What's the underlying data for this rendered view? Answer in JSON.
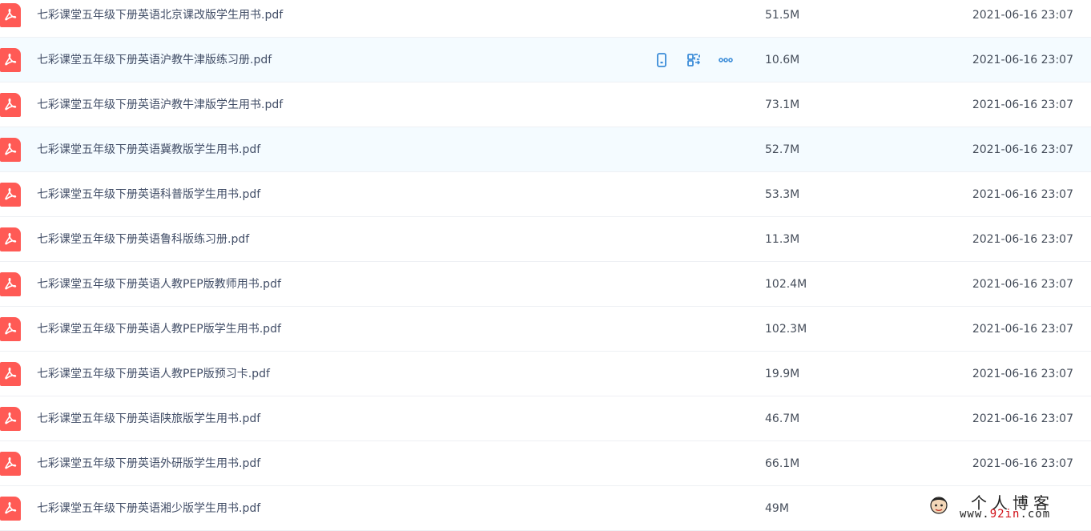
{
  "files": [
    {
      "name": "七彩课堂五年级下册英语北京课改版学生用书.pdf",
      "size": "51.5M",
      "date": "2021-06-16 23:07"
    },
    {
      "name": "七彩课堂五年级下册英语沪教牛津版练习册.pdf",
      "size": "10.6M",
      "date": "2021-06-16 23:07"
    },
    {
      "name": "七彩课堂五年级下册英语沪教牛津版学生用书.pdf",
      "size": "73.1M",
      "date": "2021-06-16 23:07"
    },
    {
      "name": "七彩课堂五年级下册英语冀教版学生用书.pdf",
      "size": "52.7M",
      "date": "2021-06-16 23:07"
    },
    {
      "name": "七彩课堂五年级下册英语科普版学生用书.pdf",
      "size": "53.3M",
      "date": "2021-06-16 23:07"
    },
    {
      "name": "七彩课堂五年级下册英语鲁科版练习册.pdf",
      "size": "11.3M",
      "date": "2021-06-16 23:07"
    },
    {
      "name": "七彩课堂五年级下册英语人教PEP版教师用书.pdf",
      "size": "102.4M",
      "date": "2021-06-16 23:07"
    },
    {
      "name": "七彩课堂五年级下册英语人教PEP版学生用书.pdf",
      "size": "102.3M",
      "date": "2021-06-16 23:07"
    },
    {
      "name": "七彩课堂五年级下册英语人教PEP版预习卡.pdf",
      "size": "19.9M",
      "date": "2021-06-16 23:07"
    },
    {
      "name": "七彩课堂五年级下册英语陕旅版学生用书.pdf",
      "size": "46.7M",
      "date": "2021-06-16 23:07"
    },
    {
      "name": "七彩课堂五年级下册英语外研版学生用书.pdf",
      "size": "66.1M",
      "date": "2021-06-16 23:07"
    },
    {
      "name": "七彩课堂五年级下册英语湘少版学生用书.pdf",
      "size": "49M",
      "date": ""
    }
  ],
  "hover_row_index": 1,
  "selected_row_index": 3,
  "row_actions": [
    "phone-icon",
    "share-link-icon",
    "more-icon"
  ],
  "accent_color": "#3b8cd8",
  "pdf_icon_color": "#ff5a55",
  "watermark": {
    "title": "个人博客",
    "url_prefix": "www.",
    "url_red": "92in",
    "url_suffix": ".com"
  }
}
